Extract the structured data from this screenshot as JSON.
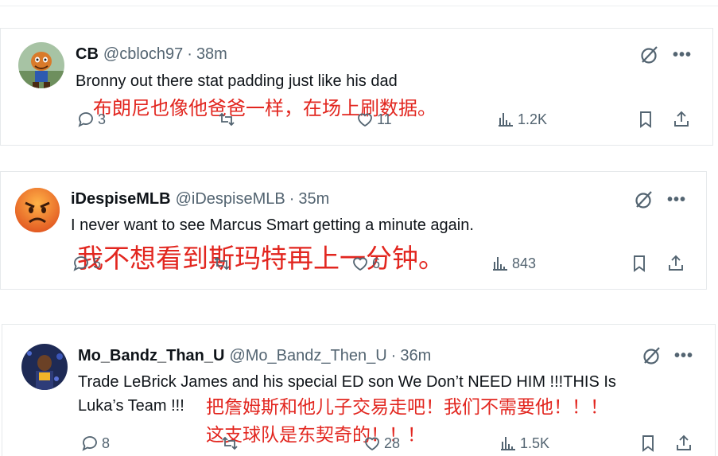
{
  "tweets": [
    {
      "name": "CB",
      "handle": "@cbloch97",
      "time": "38m",
      "text": "Bronny out there stat padding just like his dad",
      "translation": "布朗尼也像他爸爸一样，在场上刷数据。",
      "replies": "3",
      "likes": "11",
      "views": "1.2K"
    },
    {
      "name": "iDespiseMLB",
      "handle": "@iDespiseMLB",
      "time": "35m",
      "text": "I never want to see Marcus Smart getting a minute again.",
      "translation": "我不想看到斯玛特再上一分钟。",
      "replies": "5",
      "likes": "6",
      "views": "843"
    },
    {
      "name": "Mo_Bandz_Than_U",
      "handle": "@Mo_Bandz_Then_U",
      "time": "36m",
      "text_line1": "Trade LeBrick James and his special ED son We Don’t NEED HIM !!!THIS Is",
      "text_line2": "Luka’s Team !!!",
      "translation_line1": "把詹姆斯和他儿子交易走吧！我们不需要他！！！",
      "translation_line2": "这支球队是东契奇的！！！",
      "replies": "8",
      "likes": "28",
      "views": "1.5K"
    }
  ],
  "separator": "·",
  "more_glyph": "•••",
  "colors": {
    "translation": "#e2261f",
    "secondary": "#536471"
  }
}
